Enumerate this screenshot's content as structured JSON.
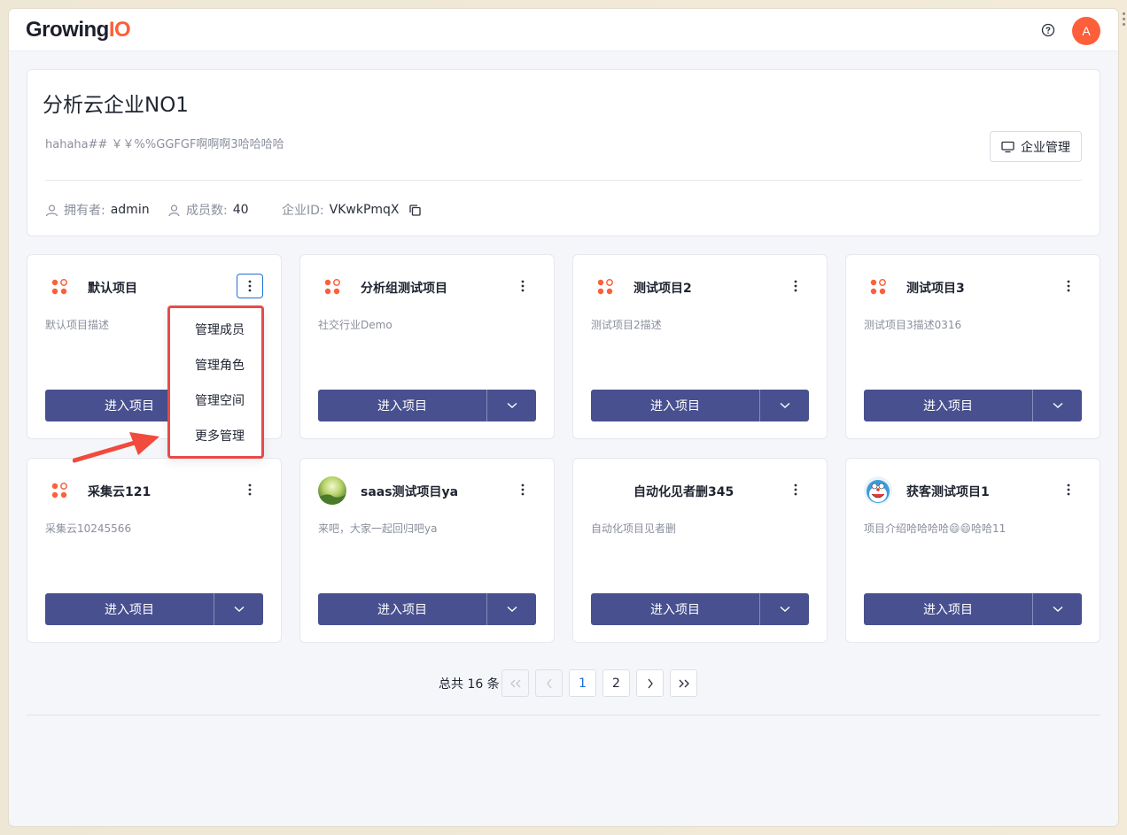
{
  "app": {
    "logo_main": "Growing",
    "logo_accent": "IO",
    "avatar_letter": "A",
    "accent_color": "#fc5f3a",
    "primary_button_color": "#48508f"
  },
  "enterprise": {
    "title": "分析云企业NO1",
    "description": "hahaha## ￥￥%%GGFGF啊啊啊3哈哈哈哈",
    "manage_button": "企业管理",
    "owner_label": "拥有者:",
    "owner_value": "admin",
    "members_label": "成员数:",
    "members_value": "40",
    "id_label": "企业ID:",
    "id_value": "VKwkPmqX"
  },
  "projects": [
    {
      "name": "默认项目",
      "description": "默认项目描述",
      "icon": "project-dots-icon",
      "enter_label": "进入项目"
    },
    {
      "name": "分析组测试项目",
      "description": "社交行业Demo",
      "icon": "project-dots-icon",
      "enter_label": "进入项目"
    },
    {
      "name": "测试项目2",
      "description": "测试项目2描述",
      "icon": "project-dots-icon",
      "enter_label": "进入项目"
    },
    {
      "name": "测试项目3",
      "description": "测试项目3描述0316",
      "icon": "project-dots-icon",
      "enter_label": "进入项目"
    },
    {
      "name": "采集云121",
      "description": "采集云10245566",
      "icon": "project-dots-icon",
      "enter_label": "进入项目"
    },
    {
      "name": "saas测试项目ya",
      "description": "来吧，大家一起回归吧ya",
      "icon": "landscape-avatar-icon",
      "enter_label": "进入项目"
    },
    {
      "name": "自动化见者删345",
      "description": "自动化项目见者删",
      "icon": "none",
      "enter_label": "进入项目"
    },
    {
      "name": "获客测试项目1",
      "description": "项目介绍哈哈哈哈😄😄哈哈11",
      "icon": "cartoon-avatar-icon",
      "enter_label": "进入项目"
    }
  ],
  "context_menu": {
    "items": [
      "管理成员",
      "管理角色",
      "管理空间",
      "更多管理"
    ]
  },
  "pagination": {
    "total_text": "总共 16 条",
    "pages": [
      "1",
      "2"
    ],
    "current": "1"
  }
}
